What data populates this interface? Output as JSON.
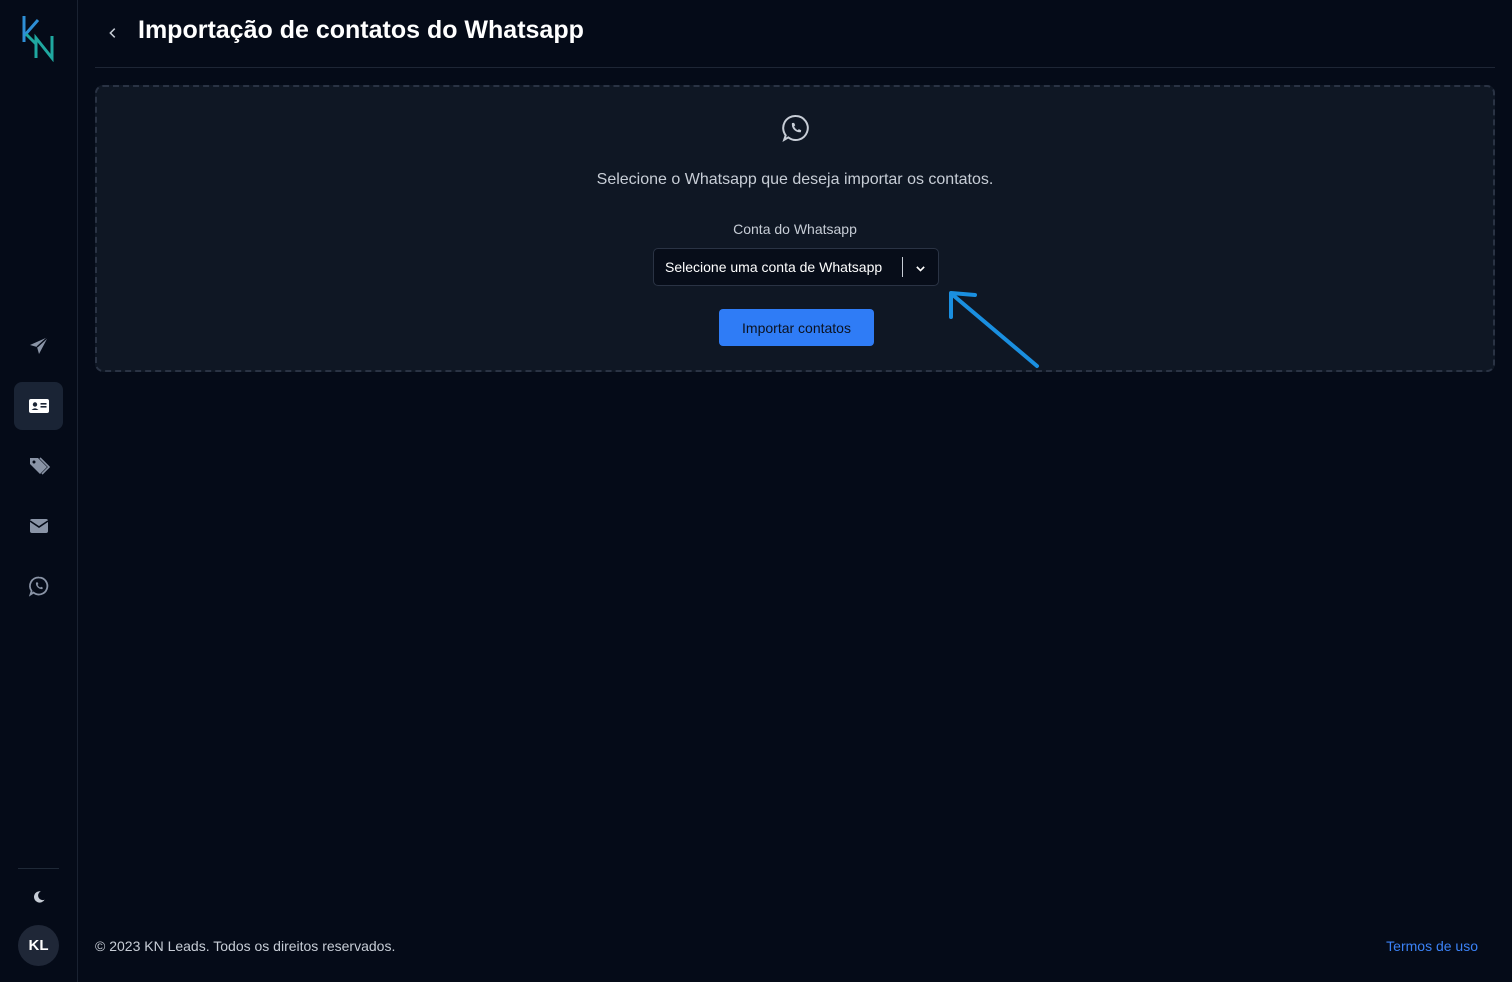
{
  "app": {
    "logo_text": "KN"
  },
  "header": {
    "title": "Importação de contatos do Whatsapp"
  },
  "sidebar": {
    "items": [
      {
        "icon": "send-icon",
        "active": false
      },
      {
        "icon": "contact-card-icon",
        "active": true
      },
      {
        "icon": "tags-icon",
        "active": false
      },
      {
        "icon": "mail-icon",
        "active": false
      },
      {
        "icon": "whatsapp-icon",
        "active": false
      }
    ],
    "theme_icon": "moon-icon",
    "avatar_initials": "KL"
  },
  "main": {
    "panel_icon": "whatsapp-icon",
    "instruction": "Selecione o Whatsapp que deseja importar os contatos.",
    "field_label": "Conta do Whatsapp",
    "select_placeholder": "Selecione uma conta de Whatsapp",
    "import_button_label": "Importar contatos"
  },
  "footer": {
    "copyright": "© 2023 KN Leads. Todos os direitos reservados.",
    "terms_link": "Termos de uso"
  },
  "colors": {
    "background": "#050b18",
    "panel": "#0f1724",
    "accent": "#2f7cf6",
    "link": "#3b82f6",
    "annotation_arrow": "#1a8fe0",
    "logo_teal": "#1fa8a0",
    "logo_blue": "#2e8fd6"
  }
}
